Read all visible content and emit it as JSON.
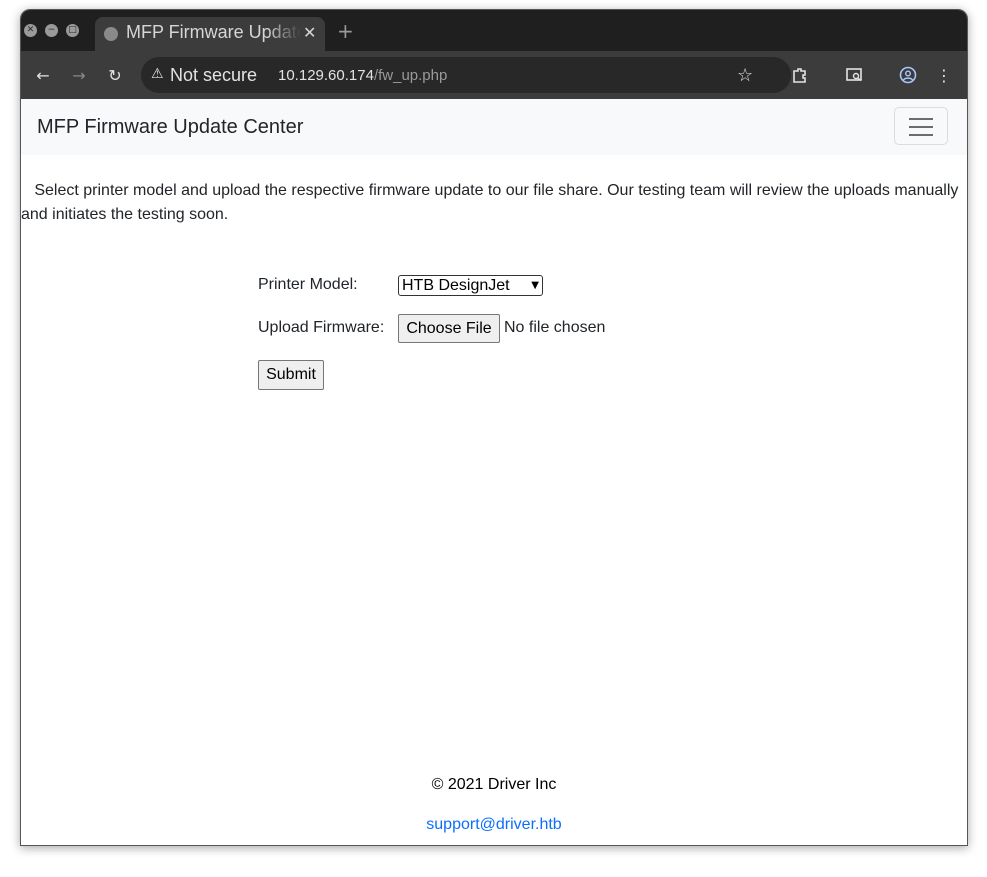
{
  "browser": {
    "tab_title": "MFP Firmware Update Center",
    "new_tab_symbol": "+",
    "security_label": "Not secure",
    "url_host": "10.129.60.174",
    "url_path": "/fw_up.php",
    "icons": [
      "close-window-icon",
      "minimize-icon",
      "maximize-icon",
      "globe-icon",
      "tab-close-icon",
      "back-icon",
      "forward-icon",
      "reload-icon",
      "warning-icon",
      "star-icon",
      "extensions-icon",
      "search-tab-icon",
      "profile-icon",
      "menu-icon"
    ]
  },
  "navbar": {
    "brand": "MFP Firmware Update Center",
    "toggle_icon": "hamburger-icon"
  },
  "main": {
    "intro": "Select printer model and upload the respective firmware update to our file share. Our testing team will review the uploads manually and initiates the testing soon.",
    "printer_model_label": "Printer Model:",
    "printer_model_value": "HTB DesignJet",
    "upload_label": "Upload Firmware:",
    "choose_file_label": "Choose File",
    "file_status": "No file chosen",
    "submit_label": "Submit"
  },
  "footer": {
    "copyright": "© 2021 Driver Inc",
    "email": "support@driver.htb"
  },
  "colors": {
    "titlebar": "#1f1f1f",
    "toolbar": "#3c3c3c",
    "navbar": "#f8f9fa",
    "link": "#0d6efd"
  }
}
